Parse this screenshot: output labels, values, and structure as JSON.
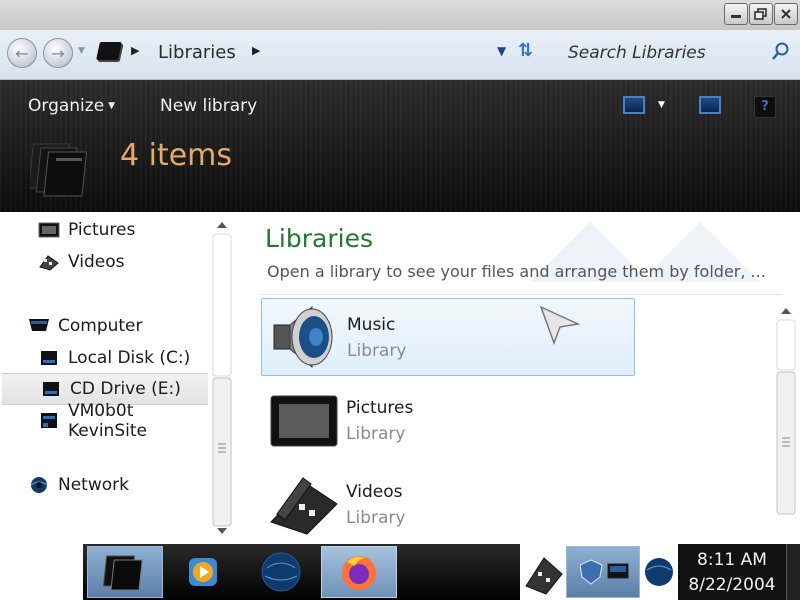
{
  "window": {
    "minimize_icon": "minimize-icon",
    "maximize_icon": "restore-icon",
    "close_icon": "close-icon"
  },
  "address_bar": {
    "location": "Libraries",
    "search_placeholder": "Search Libraries"
  },
  "toolbar": {
    "organize_label": "Organize",
    "new_library_label": "New library"
  },
  "details": {
    "item_count": "4 items"
  },
  "nav_pane": {
    "items": [
      {
        "label": "Pictures",
        "icon": "pictures-icon"
      },
      {
        "label": "Videos",
        "icon": "videos-icon"
      },
      {
        "label": "Computer",
        "icon": "computer-icon"
      },
      {
        "label": "Local Disk (C:)",
        "icon": "local-disk-icon"
      },
      {
        "label": "CD Drive (E:)",
        "icon": "cd-drive-icon",
        "selected": true
      },
      {
        "label": "VM0b0t KevinSite",
        "icon": "network-drive-icon"
      },
      {
        "label": "Network",
        "icon": "network-icon"
      }
    ]
  },
  "content": {
    "title": "Libraries",
    "subtitle": "Open a library to see your files and arrange them by folder, ...",
    "libraries": [
      {
        "name": "Music",
        "type": "Library",
        "icon": "music-library-icon"
      },
      {
        "name": "Pictures",
        "type": "Library",
        "icon": "pictures-library-icon"
      },
      {
        "name": "Videos",
        "type": "Library",
        "icon": "videos-library-icon"
      }
    ]
  },
  "taskbar": {
    "time": "8:11 AM",
    "date": "8/22/2004"
  },
  "colors": {
    "title_green": "#1e7a2f",
    "item_count_orange": "#e8a86a",
    "hover_blue": "#8fc1e8"
  }
}
